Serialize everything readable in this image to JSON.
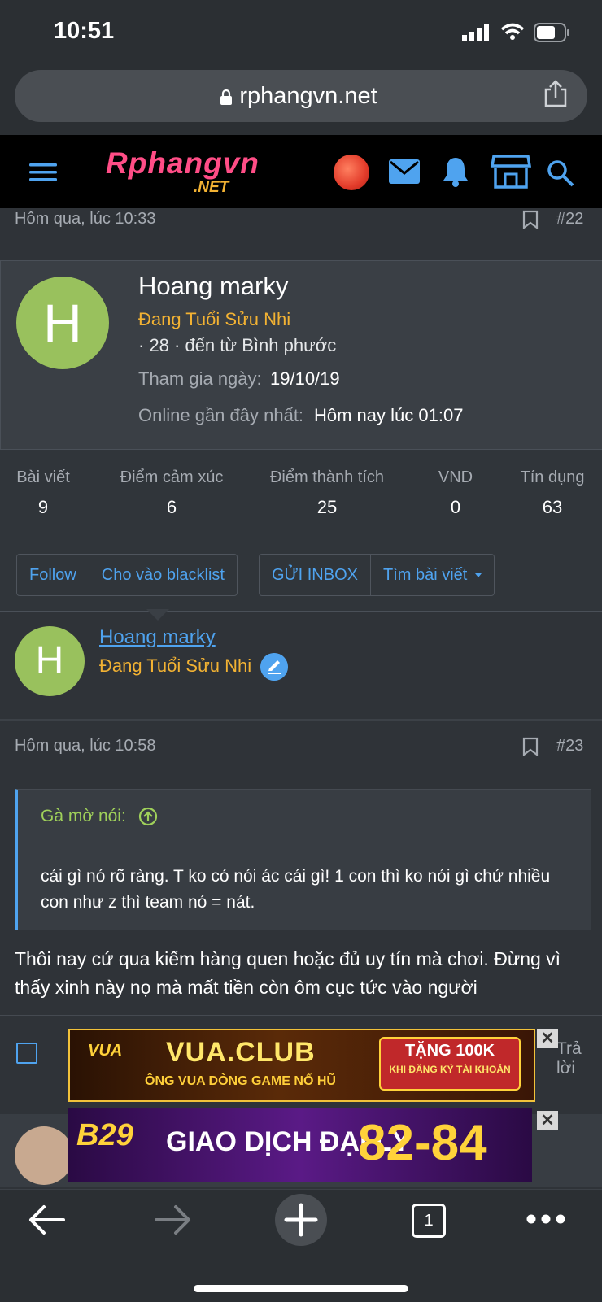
{
  "status_bar": {
    "time": "10:51"
  },
  "browser": {
    "url": "rphangvn.net",
    "tab_count": "1"
  },
  "site": {
    "logo_main": "Rphangvn",
    "logo_sub": ".NET"
  },
  "post1": {
    "date": "Hôm qua, lúc 10:33",
    "number": "#22"
  },
  "user_card": {
    "avatar_letter": "H",
    "name": "Hoang marky",
    "title": "Đang Tuổi Sửu Nhi",
    "age_location": "· 28 · đến từ Bình phước",
    "joined_label": "Tham gia ngày:",
    "joined_value": "19/10/19",
    "online_label": "Online gần đây nhất:",
    "online_value": "Hôm nay lúc 01:07",
    "stats": [
      {
        "label": "Bài viết",
        "value": "9"
      },
      {
        "label": "Điểm cảm xúc",
        "value": "6"
      },
      {
        "label": "Điểm thành tích",
        "value": "25"
      },
      {
        "label": "VND",
        "value": "0"
      },
      {
        "label": "Tín dụng",
        "value": "63"
      }
    ],
    "buttons": {
      "follow": "Follow",
      "blacklist": "Cho vào blacklist",
      "inbox": "GỬI INBOX",
      "find_posts": "Tìm bài viết"
    }
  },
  "poster": {
    "avatar_letter": "H",
    "name": "Hoang marky",
    "title": "Đang Tuổi Sửu Nhi"
  },
  "post2": {
    "date": "Hôm qua, lúc 10:58",
    "number": "#23",
    "quote_author": "Gà mờ nói:",
    "quote_text": "cái gì nó rõ ràng. T ko có nói ác cái gì! 1 con thì ko nói gì chứ nhiều con như z thì team nó = nát.",
    "body": "Thôi nay cứ qua kiếm hàng quen hoặc đủ uy tín mà chơi. Đừng vì thấy xinh này nọ mà mất tiền còn ôm cục tức vào người",
    "reply_label": "Trả lời"
  },
  "ads": {
    "banner1": {
      "brand": "VUA",
      "title": "VUA.CLUB",
      "subtitle": "ÔNG VUA DÒNG GAME NỔ HŨ",
      "promo_line1": "TẶNG 100K",
      "promo_line2": "KHI ĐĂNG KÝ TÀI KHOẢN"
    },
    "banner2": {
      "brand": "B29",
      "title": "GIAO DỊCH ĐẠI LÝ",
      "number": "82-84"
    },
    "close_label": "✕"
  },
  "colors": {
    "accent": "#4fa3ef",
    "title_gold": "#f2b233",
    "quote_green": "#9fd05a",
    "avatar_green": "#99c15d"
  }
}
